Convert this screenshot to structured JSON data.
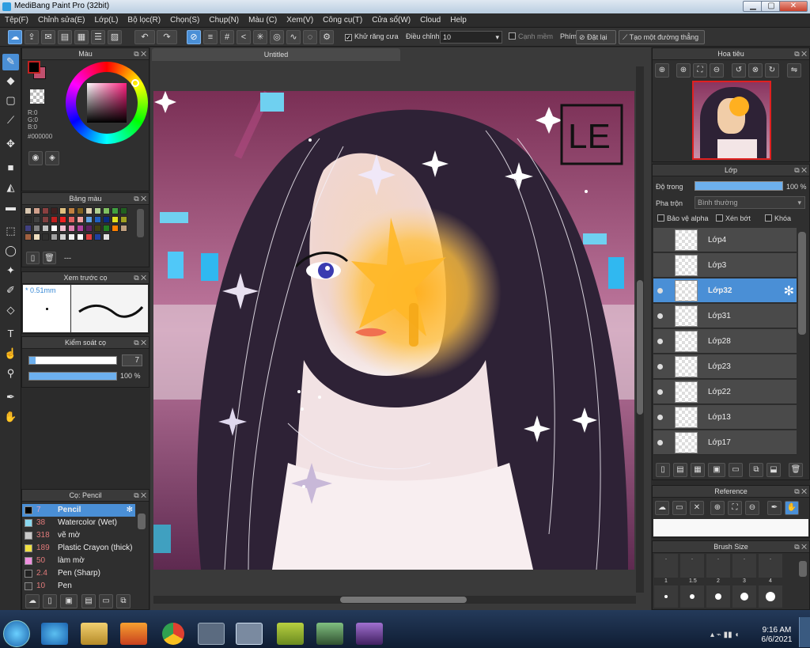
{
  "window": {
    "title": "MediBang Paint Pro (32bit)",
    "min": "▁",
    "max": "▢",
    "close": "✕"
  },
  "menu": [
    "Tệp(F)",
    "Chỉnh sửa(E)",
    "Lớp(L)",
    "Bộ lọc(R)",
    "Chọn(S)",
    "Chụp(N)",
    "Màu (C)",
    "Xem(V)",
    "Công cụ(T)",
    "Cửa sổ(W)",
    "Cloud",
    "Help"
  ],
  "toolbar": {
    "antialias": "Khử răng cưa",
    "adjust_label": "Điều chỉnh",
    "adjust_value": "10",
    "soft_edge": "Cạnh mềm",
    "key_label": "Phím",
    "reset": "Đặt lại",
    "straight_line": "Tạo một đường thẳng"
  },
  "color_panel": {
    "title": "Màu",
    "r": "R:0",
    "g": "G:0",
    "b": "B:0",
    "hex": "#000000",
    "fg": "#000000",
    "bg": "#c0506e"
  },
  "palette_panel": {
    "title": "Bảng màu",
    "dots": "---",
    "swatches": [
      "#d7c6b0",
      "#d0a08c",
      "#8a4040",
      "#402020",
      "#e0c080",
      "#c08040",
      "#806020",
      "#e0d0b0",
      "#b0d090",
      "#80c060",
      "#40a040",
      "#206020",
      "#2a2a2a",
      "#404040",
      "#804040",
      "#c02020",
      "#f02020",
      "#e06060",
      "#f0a0a0",
      "#60a0e0",
      "#2060c0",
      "#0a2a80",
      "#e0e020",
      "#a0a020",
      "#404080",
      "#808080",
      "#c0c0c0",
      "#ffffff",
      "#f0c0d0",
      "#e080b0",
      "#b040a0",
      "#602060",
      "#404010",
      "#208020",
      "#ff8000",
      "#c0a080",
      "#a06040",
      "#f0e0c0",
      "#303030",
      "#a0a0a0",
      "#d0d0d0",
      "#f0f0f0",
      "#ffffff",
      "#e04040",
      "#2040a0",
      "#e0e0e0"
    ]
  },
  "preview_panel": {
    "title": "Xem trước cọ",
    "size": "* 0.51mm"
  },
  "control_panel": {
    "title": "Kiểm soát cọ",
    "size_value": "7",
    "opacity_value": "100 %",
    "size_fraction": 0.07,
    "opacity_fraction": 1.0
  },
  "brush_panel": {
    "title": "Cọ: Pencil",
    "items": [
      {
        "size": "7",
        "name": "Pencil",
        "color": "#000000"
      },
      {
        "size": "38",
        "name": "Watercolor (Wet)",
        "color": "#8ad8f0"
      },
      {
        "size": "318",
        "name": "vẽ mờ",
        "color": "#c8c8c8"
      },
      {
        "size": "189",
        "name": "Plastic Crayon (thick)",
        "color": "#f0e040"
      },
      {
        "size": "50",
        "name": "làm mờ",
        "color": "#f090e0"
      },
      {
        "size": "2.4",
        "name": "Pen (Sharp)",
        "color": "#222222"
      },
      {
        "size": "10",
        "name": "Pen",
        "color": "#333333"
      }
    ]
  },
  "document": {
    "tab": "Untitled"
  },
  "artwork": {
    "signature": "LE"
  },
  "navigator_panel": {
    "title": "Hoa tiêu"
  },
  "layer_panel": {
    "title": "Lớp",
    "opacity_label": "Độ trong",
    "opacity_value": "100 %",
    "blend_label": "Pha trộn",
    "blend_value": "Bình thường",
    "protect_alpha": "Bảo vệ alpha",
    "clipping": "Xén bớt",
    "lock": "Khóa",
    "layers": [
      "Lớp4",
      "Lớp3",
      "Lớp32",
      "Lớp31",
      "Lớp28",
      "Lớp23",
      "Lớp22",
      "Lớp13",
      "Lớp17"
    ]
  },
  "reference_panel": {
    "title": "Reference"
  },
  "brush_size_panel": {
    "title": "Brush Size",
    "labels": [
      ".",
      ".",
      ".",
      ".",
      ".",
      "1",
      "1.5",
      "2",
      "3",
      "4"
    ]
  },
  "taskbar": {
    "time": "9:16 AM",
    "date": "6/6/2021"
  }
}
